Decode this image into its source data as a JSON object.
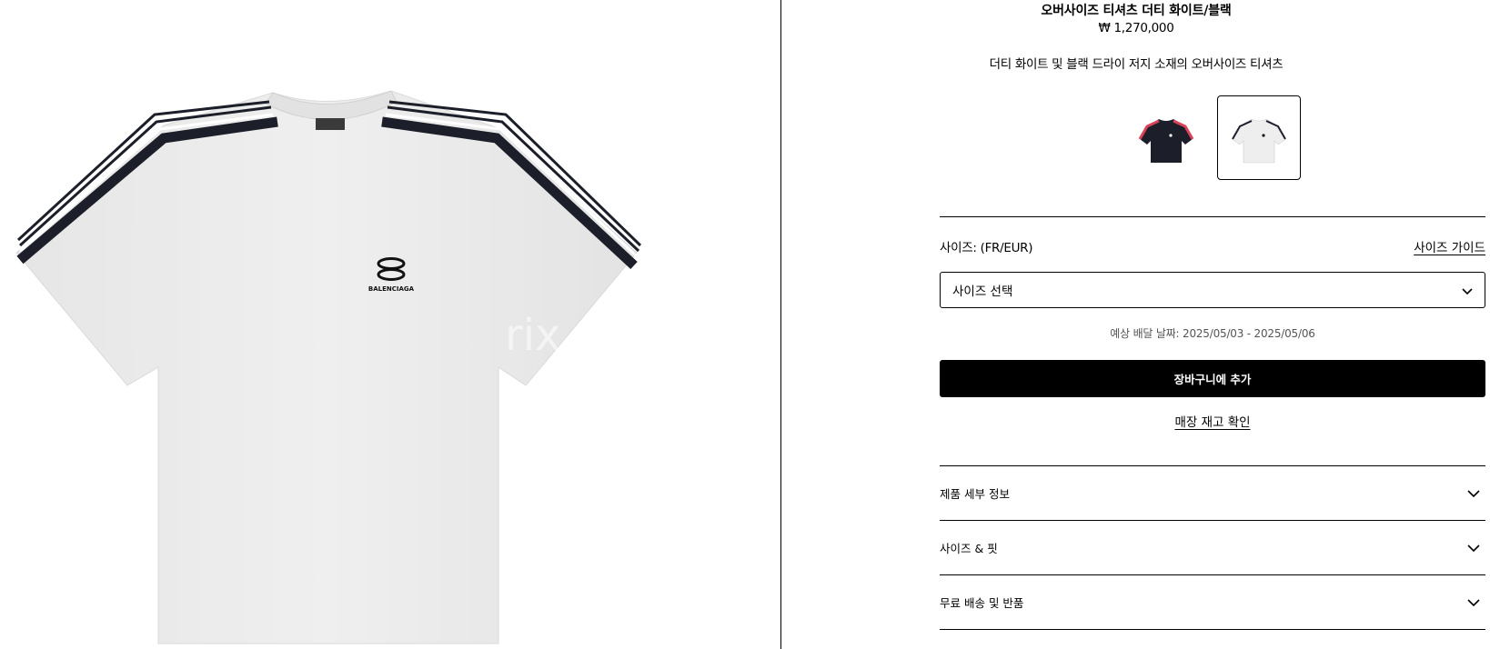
{
  "product": {
    "title": "오버사이즈 티셔츠 더티 화이트/블랙",
    "price": "₩ 1,270,000",
    "description": "더티 화이트 및 블랙 드라이 저지 소재의 오버사이즈 티셔츠",
    "brand_print": "BALENCIAGA",
    "watermark": "rix"
  },
  "swatches": [
    {
      "name": "black",
      "color": "#1c1f2a",
      "accent": "#d9435a",
      "selected": false
    },
    {
      "name": "white",
      "color": "#f0f0f0",
      "accent": "#1c1f2a",
      "selected": true
    }
  ],
  "size": {
    "label": "사이즈: (FR/EUR)",
    "guide_label": "사이즈 가이드",
    "select_placeholder": "사이즈 선택"
  },
  "delivery": "예상 배달 날짜: 2025/05/03 - 2025/05/06",
  "actions": {
    "add_to_cart": "장바구니에 추가",
    "store_stock": "매장 재고 확인"
  },
  "accordion": [
    {
      "label": "제품 세부 정보"
    },
    {
      "label": "사이즈 & 핏"
    },
    {
      "label": "무료 배송 및 반품"
    }
  ],
  "colors": {
    "stripe_dark": "#1c1f2a",
    "shirt": "#eeeeee"
  }
}
